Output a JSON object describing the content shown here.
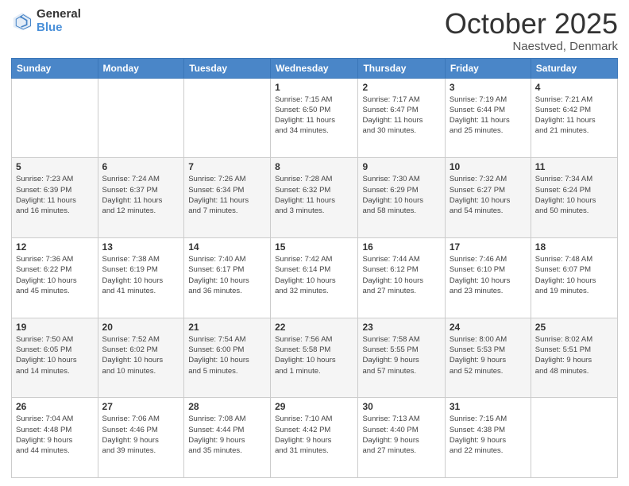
{
  "logo": {
    "general": "General",
    "blue": "Blue"
  },
  "header": {
    "month": "October 2025",
    "location": "Naestved, Denmark"
  },
  "weekdays": [
    "Sunday",
    "Monday",
    "Tuesday",
    "Wednesday",
    "Thursday",
    "Friday",
    "Saturday"
  ],
  "weeks": [
    [
      {
        "day": "",
        "info": ""
      },
      {
        "day": "",
        "info": ""
      },
      {
        "day": "",
        "info": ""
      },
      {
        "day": "1",
        "info": "Sunrise: 7:15 AM\nSunset: 6:50 PM\nDaylight: 11 hours\nand 34 minutes."
      },
      {
        "day": "2",
        "info": "Sunrise: 7:17 AM\nSunset: 6:47 PM\nDaylight: 11 hours\nand 30 minutes."
      },
      {
        "day": "3",
        "info": "Sunrise: 7:19 AM\nSunset: 6:44 PM\nDaylight: 11 hours\nand 25 minutes."
      },
      {
        "day": "4",
        "info": "Sunrise: 7:21 AM\nSunset: 6:42 PM\nDaylight: 11 hours\nand 21 minutes."
      }
    ],
    [
      {
        "day": "5",
        "info": "Sunrise: 7:23 AM\nSunset: 6:39 PM\nDaylight: 11 hours\nand 16 minutes."
      },
      {
        "day": "6",
        "info": "Sunrise: 7:24 AM\nSunset: 6:37 PM\nDaylight: 11 hours\nand 12 minutes."
      },
      {
        "day": "7",
        "info": "Sunrise: 7:26 AM\nSunset: 6:34 PM\nDaylight: 11 hours\nand 7 minutes."
      },
      {
        "day": "8",
        "info": "Sunrise: 7:28 AM\nSunset: 6:32 PM\nDaylight: 11 hours\nand 3 minutes."
      },
      {
        "day": "9",
        "info": "Sunrise: 7:30 AM\nSunset: 6:29 PM\nDaylight: 10 hours\nand 58 minutes."
      },
      {
        "day": "10",
        "info": "Sunrise: 7:32 AM\nSunset: 6:27 PM\nDaylight: 10 hours\nand 54 minutes."
      },
      {
        "day": "11",
        "info": "Sunrise: 7:34 AM\nSunset: 6:24 PM\nDaylight: 10 hours\nand 50 minutes."
      }
    ],
    [
      {
        "day": "12",
        "info": "Sunrise: 7:36 AM\nSunset: 6:22 PM\nDaylight: 10 hours\nand 45 minutes."
      },
      {
        "day": "13",
        "info": "Sunrise: 7:38 AM\nSunset: 6:19 PM\nDaylight: 10 hours\nand 41 minutes."
      },
      {
        "day": "14",
        "info": "Sunrise: 7:40 AM\nSunset: 6:17 PM\nDaylight: 10 hours\nand 36 minutes."
      },
      {
        "day": "15",
        "info": "Sunrise: 7:42 AM\nSunset: 6:14 PM\nDaylight: 10 hours\nand 32 minutes."
      },
      {
        "day": "16",
        "info": "Sunrise: 7:44 AM\nSunset: 6:12 PM\nDaylight: 10 hours\nand 27 minutes."
      },
      {
        "day": "17",
        "info": "Sunrise: 7:46 AM\nSunset: 6:10 PM\nDaylight: 10 hours\nand 23 minutes."
      },
      {
        "day": "18",
        "info": "Sunrise: 7:48 AM\nSunset: 6:07 PM\nDaylight: 10 hours\nand 19 minutes."
      }
    ],
    [
      {
        "day": "19",
        "info": "Sunrise: 7:50 AM\nSunset: 6:05 PM\nDaylight: 10 hours\nand 14 minutes."
      },
      {
        "day": "20",
        "info": "Sunrise: 7:52 AM\nSunset: 6:02 PM\nDaylight: 10 hours\nand 10 minutes."
      },
      {
        "day": "21",
        "info": "Sunrise: 7:54 AM\nSunset: 6:00 PM\nDaylight: 10 hours\nand 5 minutes."
      },
      {
        "day": "22",
        "info": "Sunrise: 7:56 AM\nSunset: 5:58 PM\nDaylight: 10 hours\nand 1 minute."
      },
      {
        "day": "23",
        "info": "Sunrise: 7:58 AM\nSunset: 5:55 PM\nDaylight: 9 hours\nand 57 minutes."
      },
      {
        "day": "24",
        "info": "Sunrise: 8:00 AM\nSunset: 5:53 PM\nDaylight: 9 hours\nand 52 minutes."
      },
      {
        "day": "25",
        "info": "Sunrise: 8:02 AM\nSunset: 5:51 PM\nDaylight: 9 hours\nand 48 minutes."
      }
    ],
    [
      {
        "day": "26",
        "info": "Sunrise: 7:04 AM\nSunset: 4:48 PM\nDaylight: 9 hours\nand 44 minutes."
      },
      {
        "day": "27",
        "info": "Sunrise: 7:06 AM\nSunset: 4:46 PM\nDaylight: 9 hours\nand 39 minutes."
      },
      {
        "day": "28",
        "info": "Sunrise: 7:08 AM\nSunset: 4:44 PM\nDaylight: 9 hours\nand 35 minutes."
      },
      {
        "day": "29",
        "info": "Sunrise: 7:10 AM\nSunset: 4:42 PM\nDaylight: 9 hours\nand 31 minutes."
      },
      {
        "day": "30",
        "info": "Sunrise: 7:13 AM\nSunset: 4:40 PM\nDaylight: 9 hours\nand 27 minutes."
      },
      {
        "day": "31",
        "info": "Sunrise: 7:15 AM\nSunset: 4:38 PM\nDaylight: 9 hours\nand 22 minutes."
      },
      {
        "day": "",
        "info": ""
      }
    ]
  ]
}
